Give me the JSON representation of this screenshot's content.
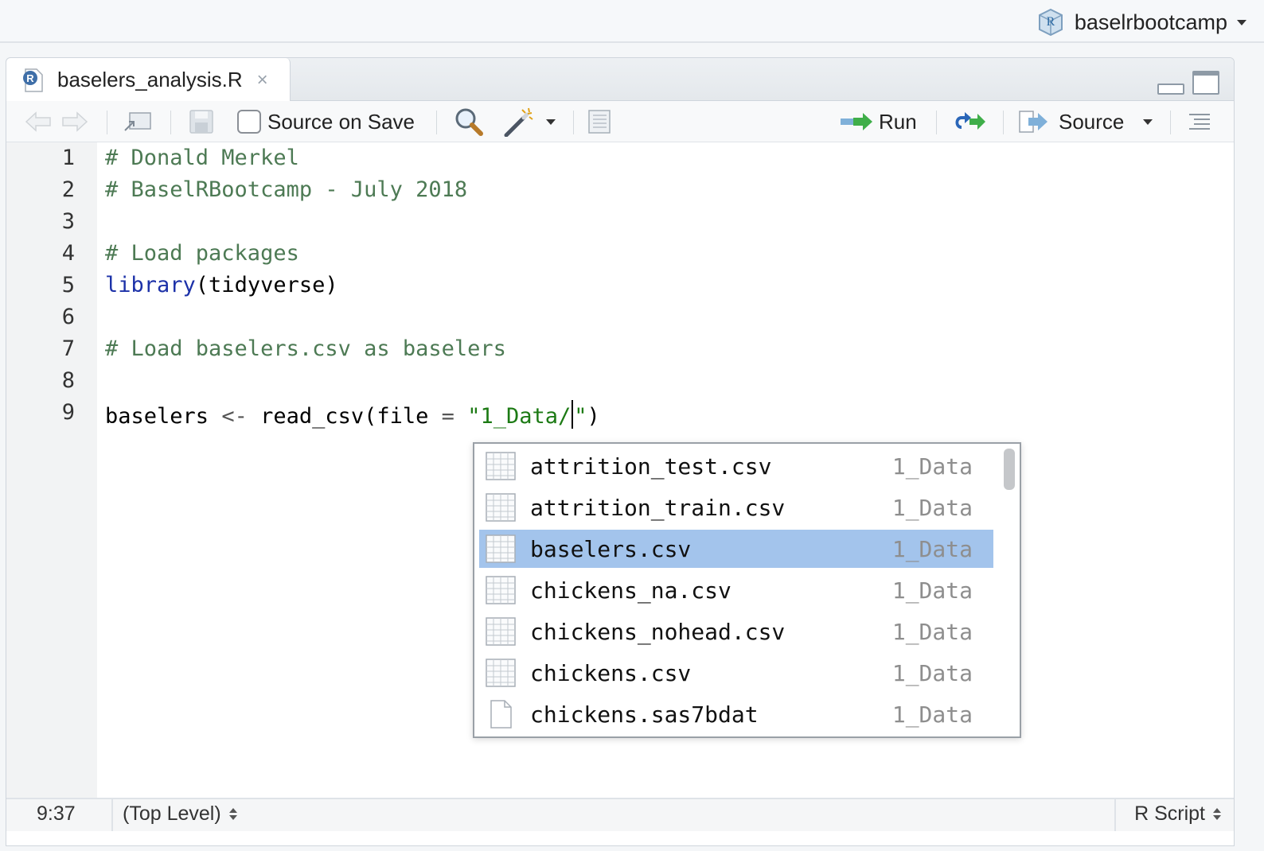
{
  "project": {
    "name": "baselrbootcamp",
    "icon": "r-project-icon"
  },
  "tab": {
    "filename": "baselers_analysis.R",
    "close": "×"
  },
  "toolbar": {
    "source_on_save": "Source on Save",
    "source_on_save_checked": false,
    "run": "Run",
    "source": "Source"
  },
  "editor": {
    "line_numbers": [
      "1",
      "2",
      "3",
      "4",
      "5",
      "6",
      "7",
      "8",
      "9"
    ],
    "lines": {
      "l1": "# Donald Merkel",
      "l2": "# BaselRBootcamp - July 2018",
      "l4": "# Load packages",
      "l5_kw": "library",
      "l5_rest": "(tidyverse)",
      "l7": "# Load baselers.csv as baselers",
      "l9_var": "baselers ",
      "l9_op": "<-",
      "l9_fn": " read_csv(file ",
      "l9_eq": "=",
      "l9_str_open": " \"1_Data/",
      "l9_str_close": "\"",
      "l9_paren": ")"
    }
  },
  "autocomplete": {
    "items": [
      {
        "name": "attrition_test.csv",
        "source": "1_Data",
        "icon": "table-file-icon",
        "selected": false
      },
      {
        "name": "attrition_train.csv",
        "source": "1_Data",
        "icon": "table-file-icon",
        "selected": false
      },
      {
        "name": "baselers.csv",
        "source": "1_Data",
        "icon": "table-file-icon",
        "selected": true
      },
      {
        "name": "chickens_na.csv",
        "source": "1_Data",
        "icon": "table-file-icon",
        "selected": false
      },
      {
        "name": "chickens_nohead.csv",
        "source": "1_Data",
        "icon": "table-file-icon",
        "selected": false
      },
      {
        "name": "chickens.csv",
        "source": "1_Data",
        "icon": "table-file-icon",
        "selected": false
      },
      {
        "name": "chickens.sas7bdat",
        "source": "1_Data",
        "icon": "blank-file-icon",
        "selected": false
      }
    ]
  },
  "status": {
    "position": "9:37",
    "scope": "(Top Level)",
    "file_type": "R Script"
  },
  "colors": {
    "comment": "#4d7a54",
    "keyword": "#1c31a8",
    "string": "#1c7a14",
    "selection": "#a3c4ec"
  }
}
